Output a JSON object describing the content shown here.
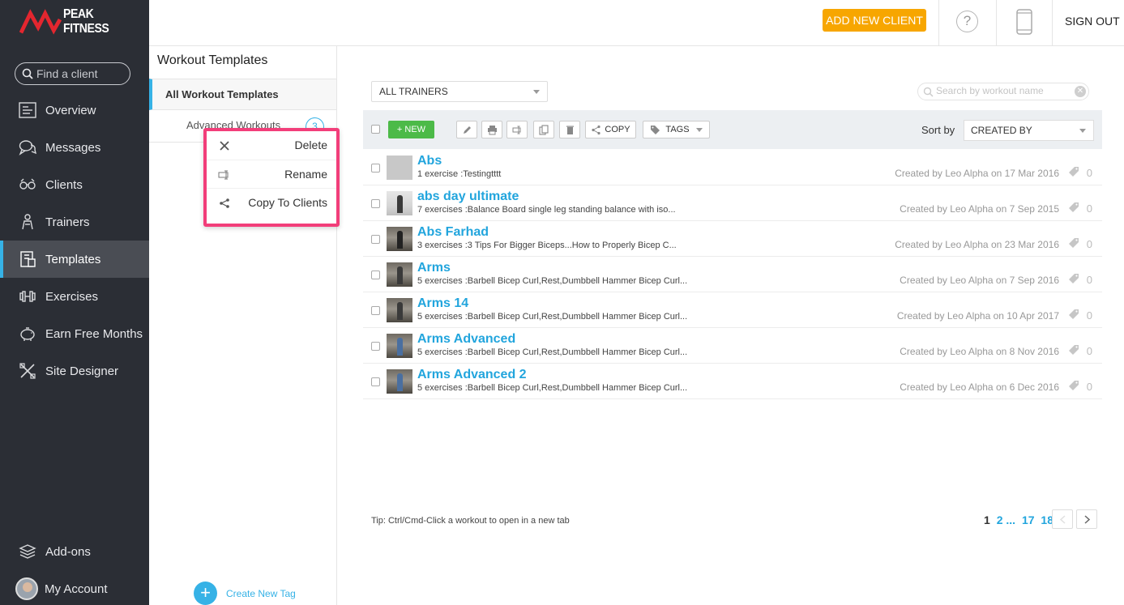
{
  "brand": {
    "name": "PEAK FITNESS"
  },
  "sidebar": {
    "search_placeholder": "Find a client",
    "items": [
      {
        "label": "Overview",
        "icon": "overview-icon"
      },
      {
        "label": "Messages",
        "icon": "messages-icon"
      },
      {
        "label": "Clients",
        "icon": "clients-icon"
      },
      {
        "label": "Trainers",
        "icon": "trainers-icon"
      },
      {
        "label": "Templates",
        "icon": "templates-icon",
        "active": true
      },
      {
        "label": "Exercises",
        "icon": "dumbbell-icon"
      },
      {
        "label": "Earn Free Months",
        "icon": "piggy-bank-icon"
      },
      {
        "label": "Site Designer",
        "icon": "site-designer-icon"
      }
    ],
    "bottom": [
      {
        "label": "Add-ons",
        "icon": "layers-icon"
      },
      {
        "label": "My Account",
        "icon": "avatar"
      }
    ]
  },
  "topbar": {
    "add_client_label": "ADD NEW CLIENT",
    "help_label": "?",
    "signout_label": "SIGN OUT"
  },
  "templates_panel": {
    "title": "Workout Templates",
    "all_label": "All Workout Templates",
    "folders": [
      {
        "label": "Advanced Workouts",
        "count": "3"
      }
    ],
    "create_tag_label": "Create New Tag"
  },
  "context_menu": {
    "items": [
      {
        "label": "Delete",
        "icon": "close-icon"
      },
      {
        "label": "Rename",
        "icon": "rename-icon"
      },
      {
        "label": "Copy To Clients",
        "icon": "share-icon"
      }
    ]
  },
  "main": {
    "trainer_filter": "ALL TRAINERS",
    "search_placeholder": "Search by workout name",
    "toolbar": {
      "new_label": "NEW",
      "copy_label": "COPY",
      "tags_label": "TAGS",
      "sort_label": "Sort by",
      "sort_value": "CREATED BY"
    },
    "workouts": [
      {
        "name": "Abs",
        "desc": "1 exercise :Testingtttt",
        "created": "Created by Leo Alpha on 17 Mar 2016",
        "tags": "0"
      },
      {
        "name": "abs day ultimate",
        "desc": "7 exercises :Balance Board single leg standing balance with iso...",
        "created": "Created by Leo Alpha on 7 Sep 2015",
        "tags": "0"
      },
      {
        "name": "Abs Farhad",
        "desc": "3 exercises :3 Tips For Bigger Biceps...How to Properly Bicep C...",
        "created": "Created by Leo Alpha on 23 Mar 2016",
        "tags": "0"
      },
      {
        "name": "Arms",
        "desc": "5 exercises :Barbell Bicep Curl,Rest,Dumbbell Hammer Bicep Curl...",
        "created": "Created by Leo Alpha on 7 Sep 2016",
        "tags": "0"
      },
      {
        "name": "Arms 14",
        "desc": "5 exercises :Barbell Bicep Curl,Rest,Dumbbell Hammer Bicep Curl...",
        "created": "Created by Leo Alpha on 10 Apr 2017",
        "tags": "0"
      },
      {
        "name": "Arms Advanced",
        "desc": "5 exercises :Barbell Bicep Curl,Rest,Dumbbell Hammer Bicep Curl...",
        "created": "Created by Leo Alpha on 8 Nov 2016",
        "tags": "0"
      },
      {
        "name": "Arms Advanced 2",
        "desc": "5 exercises :Barbell Bicep Curl,Rest,Dumbbell Hammer Bicep Curl...",
        "created": "Created by Leo Alpha on 6 Dec 2016",
        "tags": "0"
      }
    ],
    "tip": "Tip: Ctrl/Cmd-Click a workout to open in a new tab",
    "pagination": {
      "current": "1",
      "pages": [
        "2",
        "...",
        "17",
        "18"
      ]
    }
  },
  "colors": {
    "accent": "#36b2e6",
    "orange": "#f7a600",
    "green": "#4cba48",
    "highlight": "#f23e7a",
    "sidebar": "#2b2e35"
  }
}
